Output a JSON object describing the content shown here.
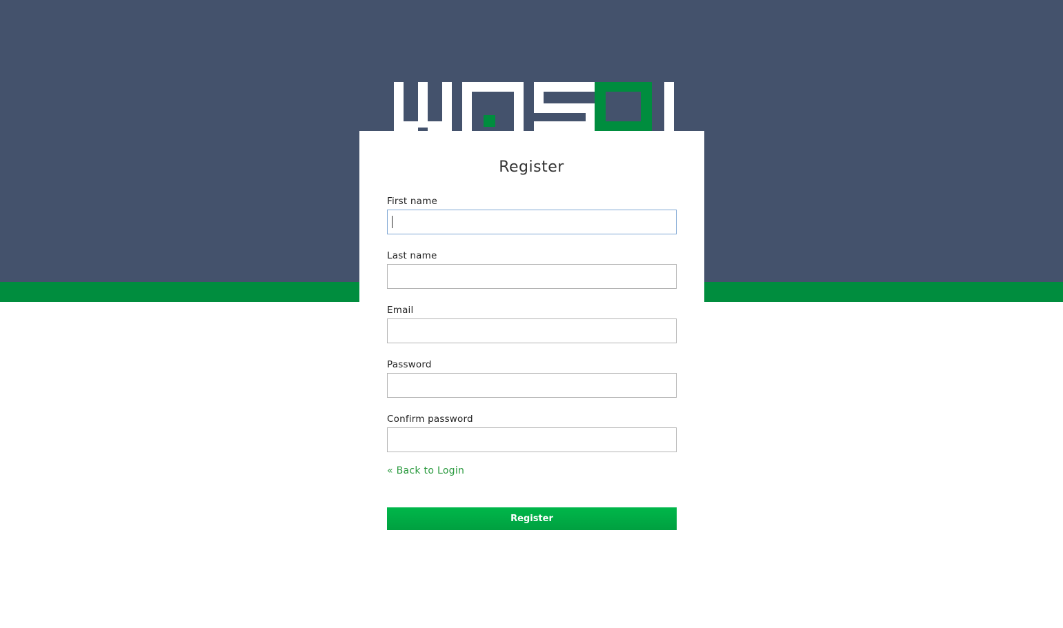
{
  "app": {
    "logo_name": "WASDI",
    "colors": {
      "header_bg": "#44526c",
      "accent_green": "#008d3e",
      "button_green": "#00a94a",
      "link_green": "#2b9a3f"
    }
  },
  "form": {
    "title": "Register",
    "fields": [
      {
        "label": "First name",
        "value": "",
        "placeholder": "",
        "focused": true
      },
      {
        "label": "Last name",
        "value": "",
        "placeholder": ""
      },
      {
        "label": "Email",
        "value": "",
        "placeholder": ""
      },
      {
        "label": "Password",
        "value": "",
        "placeholder": ""
      },
      {
        "label": "Confirm password",
        "value": "",
        "placeholder": ""
      }
    ],
    "back_link": "« Back to Login",
    "submit_label": "Register"
  }
}
